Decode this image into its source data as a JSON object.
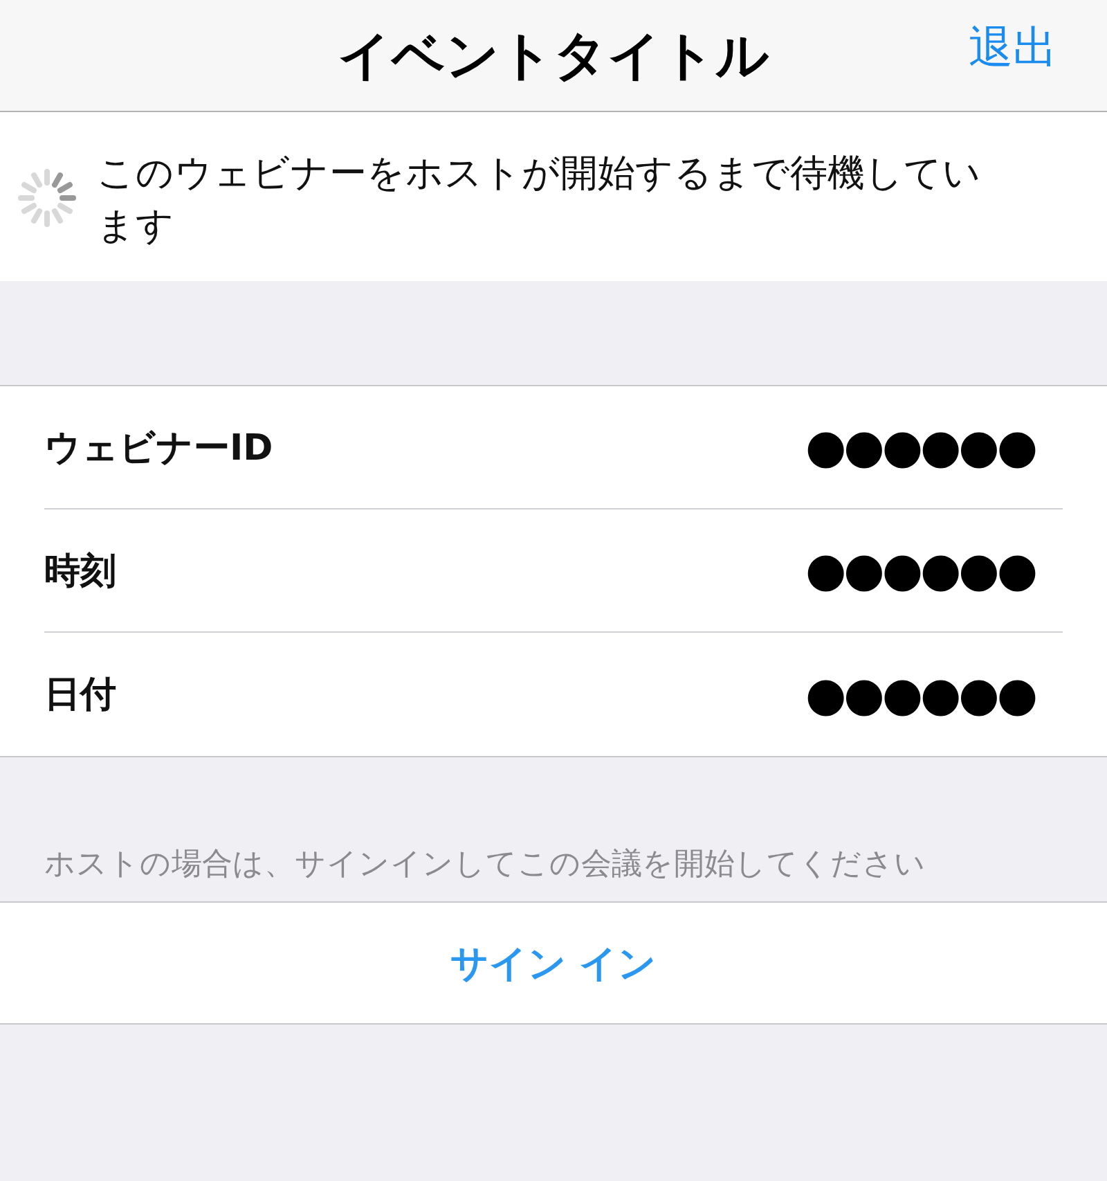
{
  "nav_bar": {
    "title": "イベントタイトル",
    "exit_button": "退出"
  },
  "status": {
    "loading": true,
    "message": "このウェビナーをホストが開始するまで待機しています"
  },
  "details": [
    {
      "label": "ウェビナーID",
      "value": "●●●●●●"
    },
    {
      "label": "時刻",
      "value": "●●●●●●"
    },
    {
      "label": "日付",
      "value": "●●●●●●"
    }
  ],
  "host_hint": "ホストの場合は、サインインしてこの会議を開始してください",
  "sign_in_button": "サイン イン"
}
